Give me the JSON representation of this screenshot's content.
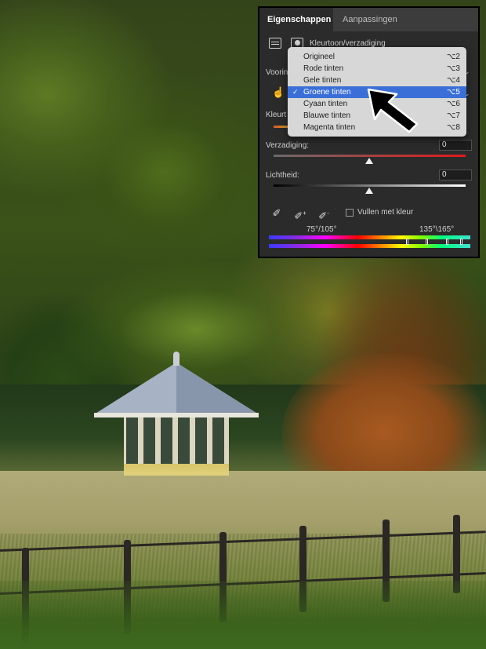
{
  "panel": {
    "tabs": [
      {
        "label": "Eigenschappen",
        "active": true
      },
      {
        "label": "Aanpassingen",
        "active": false
      }
    ],
    "adjustment_title": "Kleurtoon/verzadiging",
    "preset_label_partial": "Voorin",
    "channel_label_partial": "Kleurt",
    "sliders": [
      {
        "label": "Verzadiging:",
        "value": "0",
        "position": 0.5
      },
      {
        "label": "Lichtheid:",
        "value": "0",
        "position": 0.5
      }
    ],
    "colorize_label": "Vullen met kleur",
    "colorize_checked": false,
    "range_left": "75°/105°",
    "range_right": "135°\\165°",
    "icons": [
      "adjustment-layer-icon",
      "mask-icon",
      "targeted-adjust-hand-icon",
      "eyedropper-icon",
      "eyedropper-plus-icon",
      "eyedropper-minus-icon"
    ]
  },
  "menu": {
    "items": [
      {
        "label": "Origineel",
        "shortcut": "⌥2",
        "selected": false
      },
      {
        "label": "Rode tinten",
        "shortcut": "⌥3",
        "selected": false
      },
      {
        "label": "Gele tinten",
        "shortcut": "⌥4",
        "selected": false
      },
      {
        "label": "Groene tinten",
        "shortcut": "⌥5",
        "selected": true
      },
      {
        "label": "Cyaan tinten",
        "shortcut": "⌥6",
        "selected": false
      },
      {
        "label": "Blauwe tinten",
        "shortcut": "⌥7",
        "selected": false
      },
      {
        "label": "Magenta tinten",
        "shortcut": "⌥8",
        "selected": false
      }
    ],
    "selected_color": "#3b6fd8"
  },
  "colors": {
    "panel_bg": "#2b2b2b",
    "tab_bar_bg": "#3c3c3c",
    "menu_bg": "#d7d7d7"
  }
}
